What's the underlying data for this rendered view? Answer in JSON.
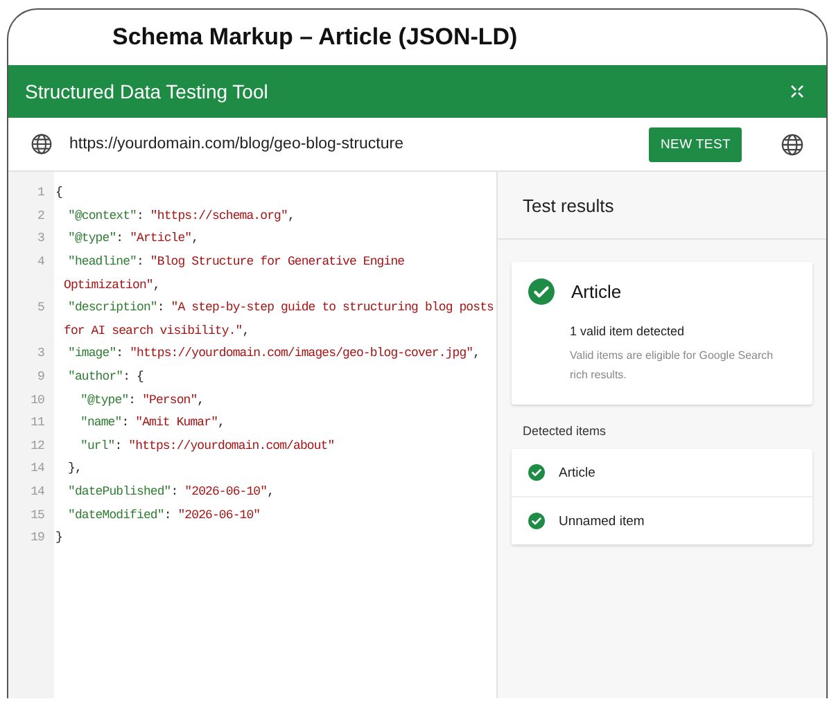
{
  "heading": "Schema Markup – Article (JSON-LD)",
  "app_bar": {
    "title": "Structured Data Testing Tool"
  },
  "url_bar": {
    "url": "https://yourdomain.com/blog/geo-blog-structure",
    "button": "NEW TEST"
  },
  "code": [
    {
      "number": "1",
      "segments": [
        {
          "kind": "punct",
          "text": "{"
        }
      ],
      "children": [
        {
          "number": "2",
          "segments": [
            {
              "kind": "key",
              "text": "\"@context\""
            },
            {
              "kind": "punct",
              "text": ": "
            },
            {
              "kind": "string",
              "text": "\"https://schema.org\""
            },
            {
              "kind": "punct",
              "text": ","
            }
          ]
        },
        {
          "number": "3",
          "segments": [
            {
              "kind": "key",
              "text": "\"@type\""
            },
            {
              "kind": "punct",
              "text": ": "
            },
            {
              "kind": "string",
              "text": "\"Article\""
            },
            {
              "kind": "punct",
              "text": ","
            }
          ]
        },
        {
          "number": "4",
          "segments": [
            {
              "kind": "key",
              "text": "\"headline\""
            },
            {
              "kind": "punct",
              "text": ": "
            },
            {
              "kind": "string",
              "text": "\"Blog Structure for Generative Engine"
            }
          ]
        },
        {
          "segments": [
            {
              "kind": "string",
              "text": "Optimization\""
            },
            {
              "kind": "punct",
              "text": ","
            }
          ]
        },
        {
          "number": "5",
          "segments": [
            {
              "kind": "key",
              "text": "\"description\""
            },
            {
              "kind": "punct",
              "text": ": "
            },
            {
              "kind": "string",
              "text": "\"A step-by-step guide to structuring blog posts"
            }
          ]
        },
        {
          "segments": [
            {
              "kind": "string",
              "text": "for AI search visibility.\""
            },
            {
              "kind": "punct",
              "text": ","
            }
          ]
        },
        {
          "number": "3",
          "segments": [
            {
              "kind": "key",
              "text": "\"image\""
            },
            {
              "kind": "punct",
              "text": ": "
            },
            {
              "kind": "string",
              "text": "\"https://yourdomain.com/images/geo-blog-cover.jpg\""
            },
            {
              "kind": "punct",
              "text": ","
            }
          ]
        },
        {
          "number": "9",
          "segments": [
            {
              "kind": "key",
              "text": "\"author\""
            },
            {
              "kind": "punct",
              "text": ": {"
            }
          ],
          "children": [
            {
              "number": "10",
              "segments": [
                {
                  "kind": "key",
                  "text": "\"@type\""
                },
                {
                  "kind": "punct",
                  "text": ": "
                },
                {
                  "kind": "string",
                  "text": "\"Person\""
                },
                {
                  "kind": "punct",
                  "text": ","
                }
              ]
            },
            {
              "number": "11",
              "segments": [
                {
                  "kind": "key",
                  "text": "\"name\""
                },
                {
                  "kind": "punct",
                  "text": ": "
                },
                {
                  "kind": "string",
                  "text": "\"Amit Kumar\""
                },
                {
                  "kind": "punct",
                  "text": ","
                }
              ]
            },
            {
              "number": "12",
              "segments": [
                {
                  "kind": "key",
                  "text": "\"url\""
                },
                {
                  "kind": "punct",
                  "text": ": "
                },
                {
                  "kind": "string",
                  "text": "\"https://yourdomain.com/about\""
                }
              ]
            }
          ]
        },
        {
          "number": "14",
          "segments": [
            {
              "kind": "punct",
              "text": "},"
            }
          ]
        },
        {
          "number": "14",
          "segments": [
            {
              "kind": "key",
              "text": "\"datePublished\""
            },
            {
              "kind": "punct",
              "text": ": "
            },
            {
              "kind": "string",
              "text": "\"2026-06-10\""
            },
            {
              "kind": "punct",
              "text": ","
            }
          ]
        },
        {
          "number": "15",
          "segments": [
            {
              "kind": "key",
              "text": "\"dateModified\""
            },
            {
              "kind": "punct",
              "text": ": "
            },
            {
              "kind": "string",
              "text": "\"2026-06-10\""
            }
          ]
        }
      ]
    },
    {
      "number": "19",
      "segments": [
        {
          "kind": "punct",
          "text": "}"
        }
      ]
    }
  ],
  "results": {
    "title": "Test results",
    "summary": {
      "title": "Article",
      "kind": "valid",
      "count": "1 valid item detected",
      "note": "Valid items are eligible for Google Search rich results."
    },
    "detected_label": "Detected items",
    "items": [
      {
        "name": "Article",
        "kind": "valid"
      },
      {
        "name": "Unnamed item",
        "kind": "valid"
      }
    ]
  }
}
